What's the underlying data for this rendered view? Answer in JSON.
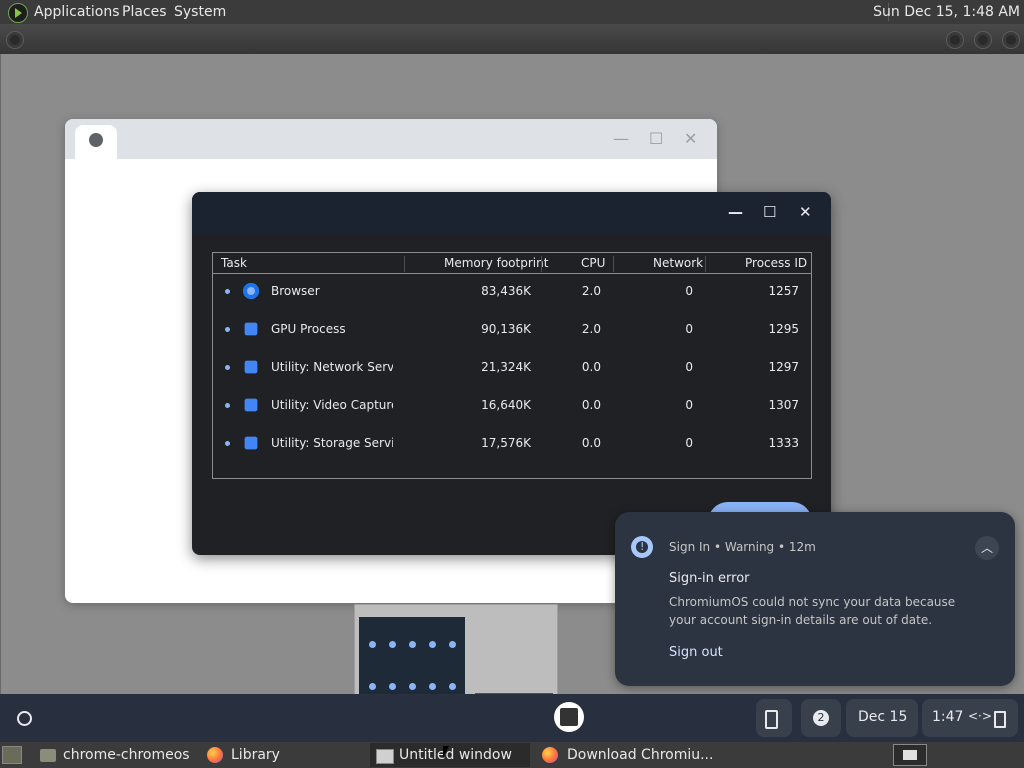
{
  "top_panel": {
    "menus": [
      "Applications",
      "Places",
      "System"
    ],
    "clock": "Sun Dec 15,  1:48 AM"
  },
  "task_manager": {
    "columns": [
      "Task",
      "Memory footprint",
      "CPU",
      "Network",
      "Process ID"
    ],
    "rows": [
      {
        "name": "Browser",
        "icon": "chrome-icon",
        "memory": "83,436K",
        "cpu": "2.0",
        "network": "0",
        "pid": "1257"
      },
      {
        "name": "GPU Process",
        "icon": "puzzle-icon",
        "memory": "90,136K",
        "cpu": "2.0",
        "network": "0",
        "pid": "1295"
      },
      {
        "name": "Utility: Network Service",
        "icon": "puzzle-icon",
        "memory": "21,324K",
        "cpu": "0.0",
        "network": "0",
        "pid": "1297"
      },
      {
        "name": "Utility: Video Capture",
        "icon": "puzzle-icon",
        "memory": "16,640K",
        "cpu": "0.0",
        "network": "0",
        "pid": "1307"
      },
      {
        "name": "Utility: Storage Service",
        "icon": "puzzle-icon",
        "memory": "17,576K",
        "cpu": "0.0",
        "network": "0",
        "pid": "1333"
      }
    ]
  },
  "notification": {
    "source": "Sign In • Warning • 12m",
    "title": "Sign-in error",
    "body": "ChromiumOS could not sync your data because your account sign-in details are out of date.",
    "action": "Sign out"
  },
  "shelf": {
    "notification_count": "2",
    "date": "Dec 15",
    "time": "1:47"
  },
  "taskbar": {
    "tasks": [
      "chrome-chromeos",
      "Library",
      "Untitled window",
      "Download Chromiu..."
    ]
  }
}
